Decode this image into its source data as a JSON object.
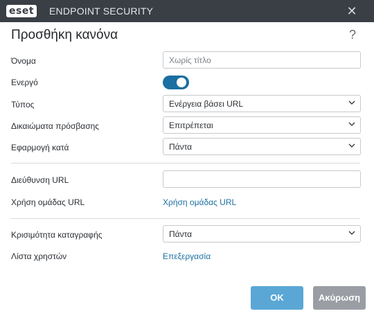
{
  "titlebar": {
    "logo_text": "eset",
    "app_name": "ENDPOINT SECURITY",
    "close_symbol": "✕"
  },
  "dialog": {
    "title": "Προσθήκη κανόνα",
    "help_symbol": "?"
  },
  "form": {
    "name": {
      "label": "Όνομα",
      "placeholder": "Χωρίς τίτλο"
    },
    "enabled": {
      "label": "Ενεργό",
      "value": true
    },
    "type": {
      "label": "Τύπος",
      "value": "Ενέργεια βάσει URL"
    },
    "access_rights": {
      "label": "Δικαιώματα πρόσβασης",
      "value": "Επιτρέπεται"
    },
    "apply_during": {
      "label": "Εφαρμογή κατά",
      "value": "Πάντα"
    },
    "url": {
      "label": "Διεύθυνση URL",
      "value": ""
    },
    "url_group": {
      "label": "Χρήση ομάδας URL",
      "link": "Χρήση ομάδας URL"
    },
    "log_severity": {
      "label": "Κρισιμότητα καταγραφής",
      "value": "Πάντα"
    },
    "user_list": {
      "label": "Λίστα χρηστών",
      "link": "Επεξεργασία"
    }
  },
  "buttons": {
    "ok": "OK",
    "cancel": "Ακύρωση"
  },
  "colors": {
    "titlebar_bg": "#3a3e45",
    "accent": "#1b6fa1",
    "ok_button": "#5aa7d6",
    "cancel_button": "#9a9ea4"
  },
  "icons": [
    "close-icon",
    "help-icon",
    "chevron-down-icon"
  ]
}
